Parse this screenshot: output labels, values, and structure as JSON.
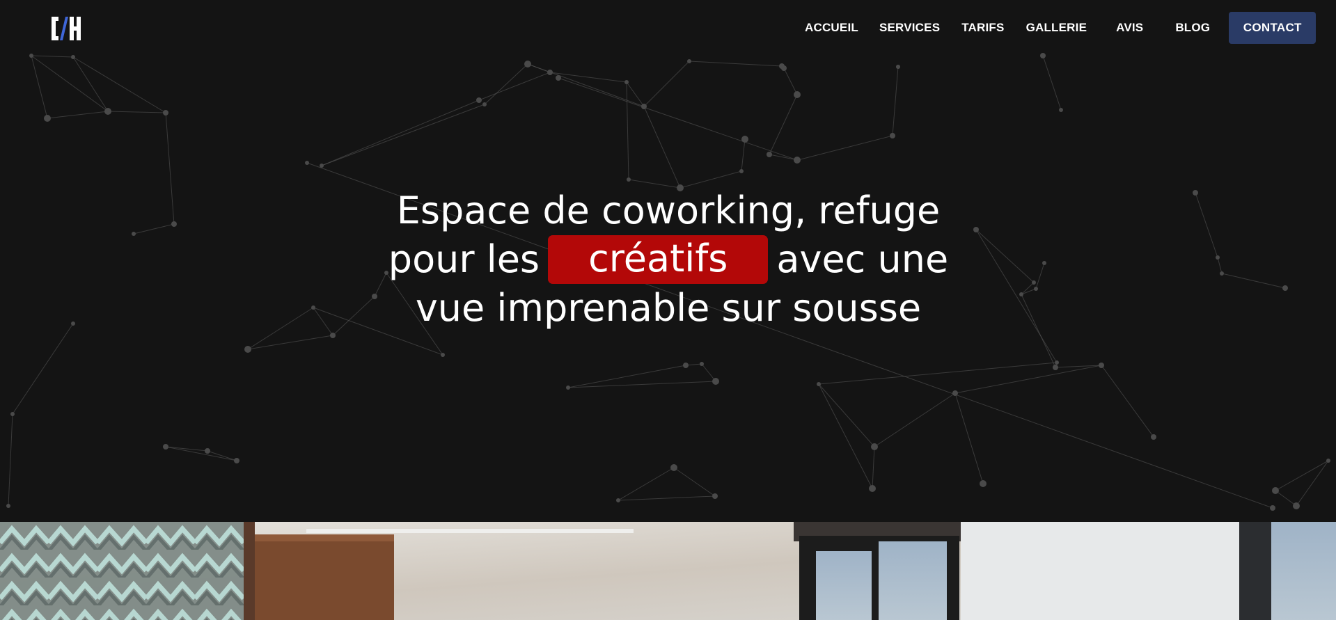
{
  "site": {
    "logo_icon": "c-h-monogram-logo"
  },
  "nav": {
    "items": [
      {
        "label": "ACCUEIL"
      },
      {
        "label": "SERVICES"
      },
      {
        "label": "TARIFS"
      },
      {
        "label": "GALLERIE"
      },
      {
        "label": "AVIS"
      },
      {
        "label": "BLOG"
      }
    ],
    "contact_label": "CONTACT"
  },
  "hero": {
    "line1": "Espace de coworking, refuge",
    "line2_before": "pour les",
    "line2_highlight": "créatifs",
    "line2_after": "avec une",
    "line3": "vue imprenable sur sousse",
    "background_icon": "network-constellation-pattern"
  },
  "colors": {
    "background": "#141414",
    "highlight": "#b30808",
    "contact_button": "#2a3b66",
    "logo_accent": "#3f66d8"
  },
  "photo": {
    "description_icon": "coworking-room-photo"
  }
}
